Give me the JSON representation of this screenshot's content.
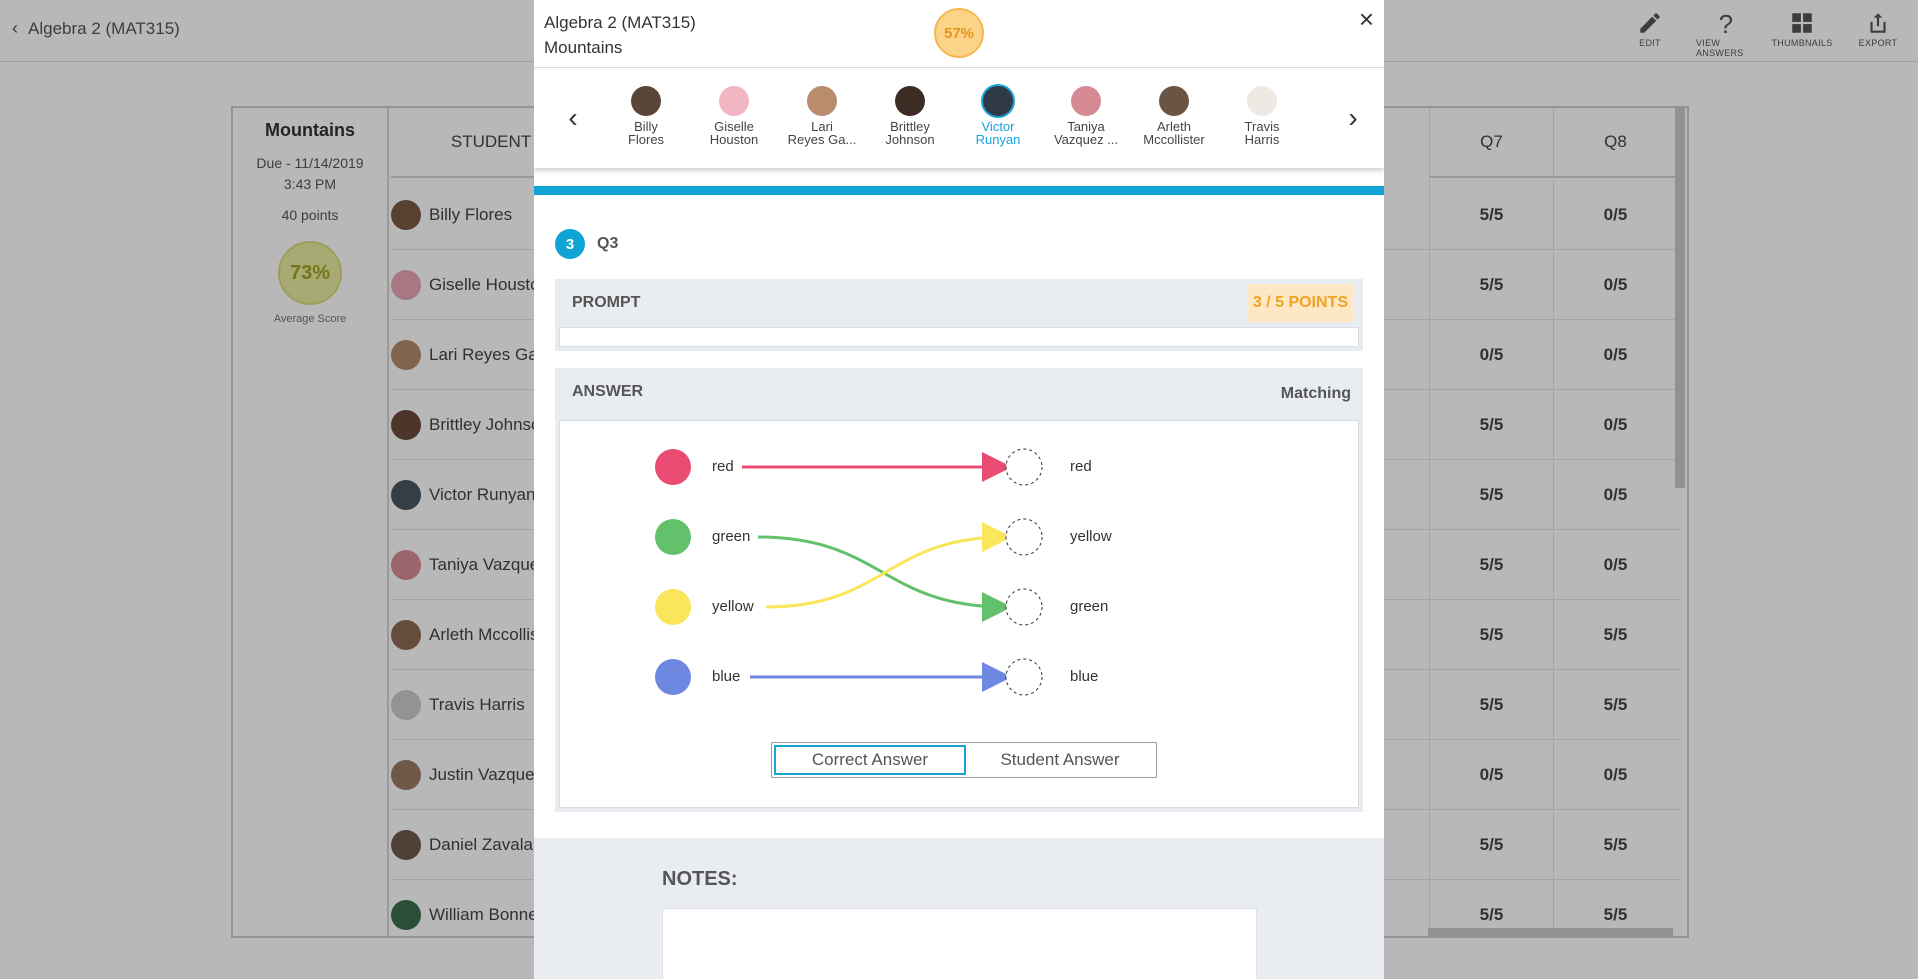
{
  "page": {
    "back_label": "Algebra 2 (MAT315)",
    "tools": [
      {
        "label": "EDIT",
        "icon": "pencil-icon"
      },
      {
        "label": "VIEW ANSWERS",
        "icon": "question-icon"
      },
      {
        "label": "THUMBNAILS",
        "icon": "grid-icon"
      },
      {
        "label": "EXPORT",
        "icon": "export-icon"
      }
    ]
  },
  "assignment": {
    "name": "Mountains",
    "due_line1": "Due - 11/14/2019",
    "due_line2": "3:43 PM",
    "points": "40 points",
    "average": "73%",
    "average_label": "Average Score"
  },
  "table": {
    "student_header": "STUDENT",
    "q7_header": "Q7",
    "q8_header": "Q8",
    "rows": [
      {
        "name": "Billy Flores",
        "q7": "5/5",
        "q8": "0/5"
      },
      {
        "name": "Giselle Houston",
        "q7": "5/5",
        "q8": "0/5"
      },
      {
        "name": "Lari Reyes Garcia",
        "q7": "0/5",
        "q8": "0/5"
      },
      {
        "name": "Brittley Johnson",
        "q7": "5/5",
        "q8": "0/5"
      },
      {
        "name": "Victor Runyan",
        "q7": "5/5",
        "q8": "0/5"
      },
      {
        "name": "Taniya Vazquez",
        "q7": "5/5",
        "q8": "0/5"
      },
      {
        "name": "Arleth Mccollister",
        "q7": "5/5",
        "q8": "5/5"
      },
      {
        "name": "Travis Harris",
        "q7": "5/5",
        "q8": "5/5"
      },
      {
        "name": "Justin Vazquez",
        "q7": "0/5",
        "q8": "0/5"
      },
      {
        "name": "Daniel Zavala",
        "q7": "5/5",
        "q8": "5/5"
      },
      {
        "name": "William Bonner",
        "q7": "5/5",
        "q8": "5/5"
      }
    ]
  },
  "modal": {
    "course": "Algebra 2 (MAT315)",
    "assignment": "Mountains",
    "score": "57%",
    "close_glyph": "×",
    "students": [
      {
        "line1": "Billy",
        "line2": "Flores"
      },
      {
        "line1": "Giselle",
        "line2": "Houston"
      },
      {
        "line1": "Lari",
        "line2": "Reyes Ga..."
      },
      {
        "line1": "Brittley",
        "line2": "Johnson"
      },
      {
        "line1": "Victor",
        "line2": "Runyan"
      },
      {
        "line1": "Taniya",
        "line2": "Vazquez ..."
      },
      {
        "line1": "Arleth",
        "line2": "Mccollister"
      },
      {
        "line1": "Travis",
        "line2": "Harris"
      }
    ],
    "selected_student": "Victor Runyan",
    "question_number": "3",
    "question_label": "Q3",
    "prompt_label": "PROMPT",
    "points": "3 / 5 POINTS",
    "answer_label": "ANSWER",
    "answer_type": "Matching",
    "matching": {
      "left": [
        {
          "label": "red",
          "color": "#e94b73"
        },
        {
          "label": "green",
          "color": "#62c16a"
        },
        {
          "label": "yellow",
          "color": "#fbe55a"
        },
        {
          "label": "blue",
          "color": "#6e87e0"
        }
      ],
      "right": [
        "red",
        "yellow",
        "green",
        "blue"
      ]
    },
    "toggle_correct": "Correct Answer",
    "toggle_student": "Student Answer",
    "notes_label": "NOTES:"
  },
  "colors": {
    "accent": "#10a3d5",
    "points_text": "#f0a425",
    "avg_badge": "#e8ec9f"
  }
}
